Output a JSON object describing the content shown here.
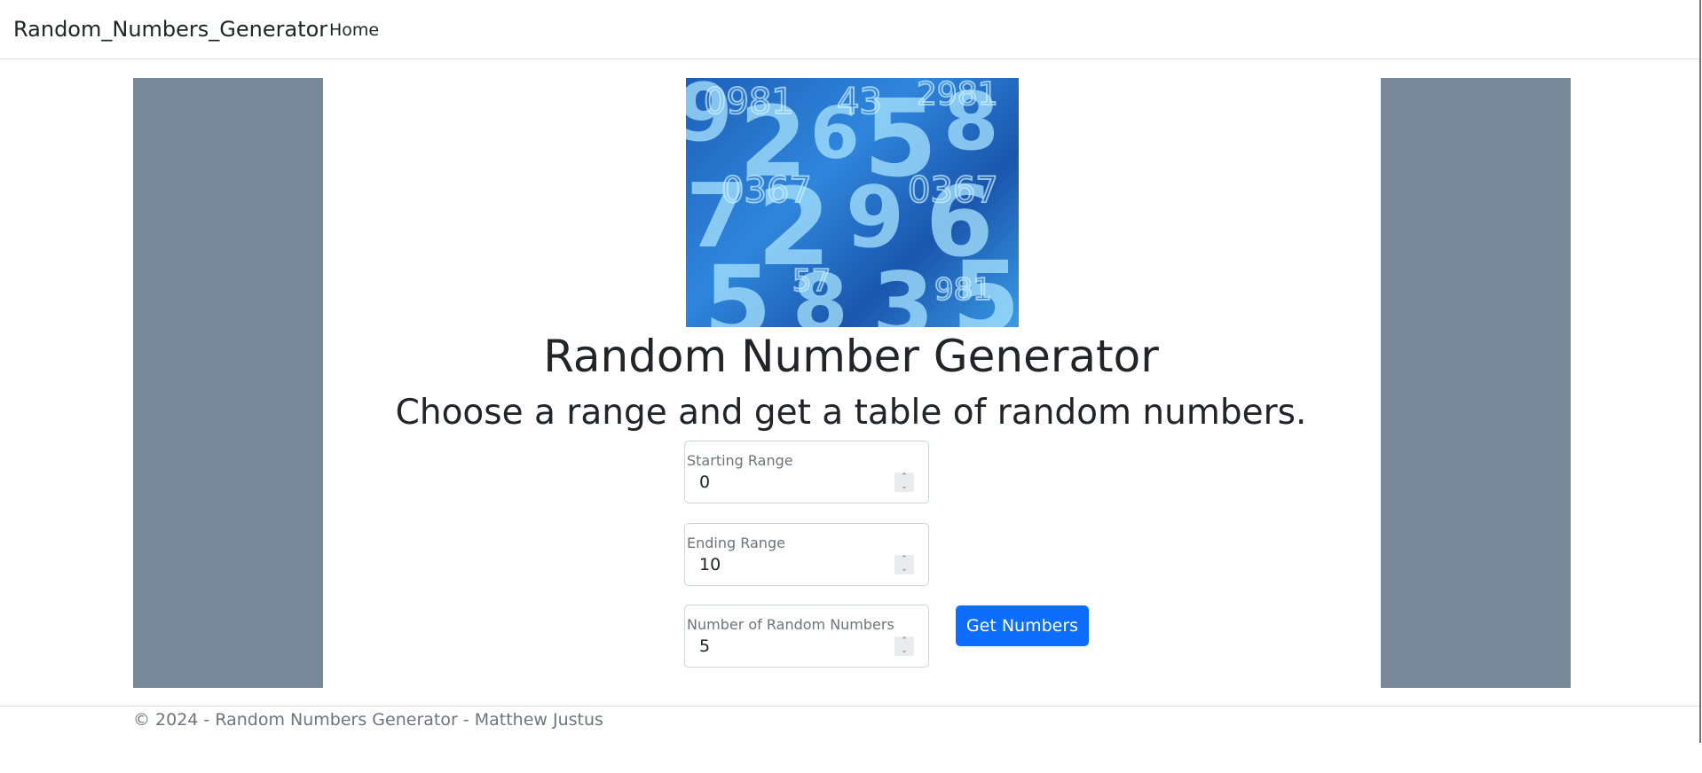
{
  "navbar": {
    "brand": "Random_Numbers_Generator",
    "links": [
      {
        "label": "Home"
      }
    ]
  },
  "hero_image": {
    "description_icon": "numbers-collage-image",
    "colors": [
      "#1e5fb8",
      "#2f86dc",
      "#9ee0ff"
    ]
  },
  "main": {
    "title": "Random Number Generator",
    "subtitle": "Choose a range and get a table of random numbers.",
    "fields": [
      {
        "label": "Starting Range",
        "value": "0"
      },
      {
        "label": "Ending Range",
        "value": "10"
      },
      {
        "label": "Number of Random Numbers",
        "value": "5"
      }
    ],
    "submit_label": "Get Numbers"
  },
  "footer": {
    "text": "© 2024 - Random Numbers Generator - Matthew Justus"
  },
  "colors": {
    "side_panel": "#778899",
    "primary_button": "#0d6efd",
    "muted_text": "#6c757d"
  }
}
